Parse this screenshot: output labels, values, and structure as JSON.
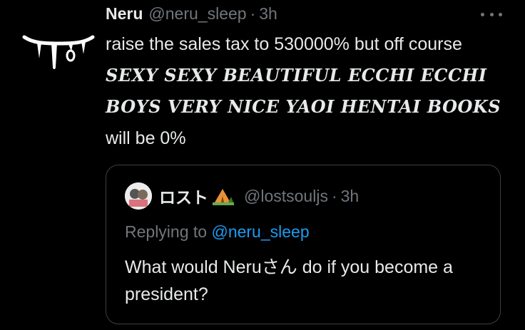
{
  "tweet": {
    "display_name": "Neru",
    "handle": "@neru_sleep",
    "separator": "·",
    "time": "3h",
    "text_part1": "raise the sales tax to 530000% but off course ",
    "text_emphasis": "SEXY SEXY BEAUTIFUL ECCHI ECCHI BOYS VERY NICE YAOI HENTAI BOOKS",
    "text_part2": " will be 0%",
    "avatar_icon": "dripping-fangs-logo-icon",
    "more_icon": "more-options-icon"
  },
  "quoted_tweet": {
    "display_name": "ロスト",
    "name_emoji": "camping-tent-icon",
    "handle": "@lostsouljs",
    "separator": "·",
    "time": "3h",
    "replying_label": "Replying to",
    "replying_mention": "@neru_sleep",
    "text": "What would Neruさん do if you become a president?"
  },
  "colors": {
    "background": "#000000",
    "primary_text": "#e7e9ea",
    "secondary_text": "#71767b",
    "link": "#1d9bf0",
    "border": "#3b3f44"
  }
}
